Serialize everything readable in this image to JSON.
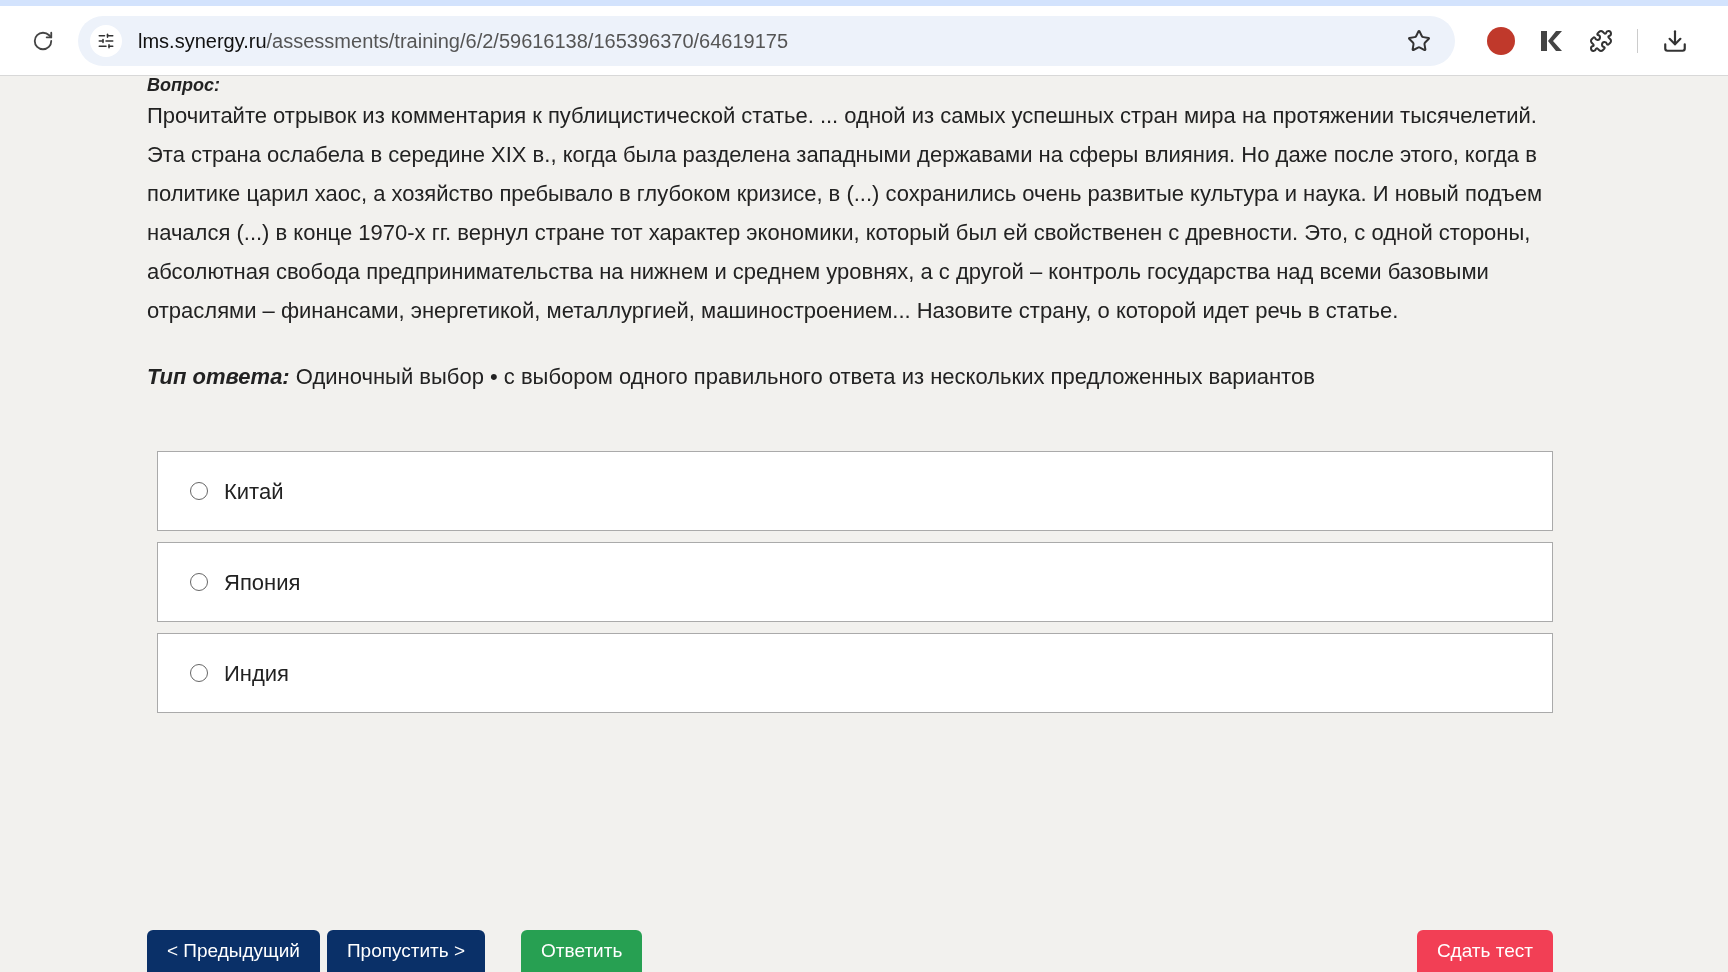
{
  "browser": {
    "url_host": "lms.synergy.ru",
    "url_path": "/assessments/training/6/2/59616138/165396370/64619175"
  },
  "question": {
    "heading": "Вопрос:",
    "text": "Прочитайте отрывок из комментария к публицистической статье. ... одной из самых успешных стран мира на протяжении тысячелетий. Эта страна ослабела в середине XIX в., когда была разделена западными державами на сферы влияния. Но даже после этого, когда в политике царил хаос, а хозяйство пребывало в глубоком кризисе, в (...) сохранились очень развитые культура и наука. И новый подъем начался (...) в конце 1970-х гг. вернул стране тот характер экономики, который был ей свойственен с древности. Это, с одной стороны, абсолютная свобода предпринимательства на нижнем и среднем уровнях, а с другой – контроль государства над всеми базовыми отраслями – финансами, энергетикой, металлургией, машиностроением... Назовите страну, о которой идет речь в статье.",
    "answer_type_label": "Тип ответа:",
    "answer_type": "Одиночный выбор • с выбором одного правильного ответа из нескольких предложенных вариантов"
  },
  "options": [
    {
      "label": "Китай",
      "selected": false
    },
    {
      "label": "Япония",
      "selected": false
    },
    {
      "label": "Индия",
      "selected": false
    }
  ],
  "buttons": [
    {
      "kind": "nav",
      "label": "< Предыдущий"
    },
    {
      "kind": "nav",
      "label": "Пропустить >"
    },
    {
      "kind": "answer",
      "label": "Ответить"
    },
    {
      "kind": "submit",
      "label": "Сдать тест"
    }
  ]
}
